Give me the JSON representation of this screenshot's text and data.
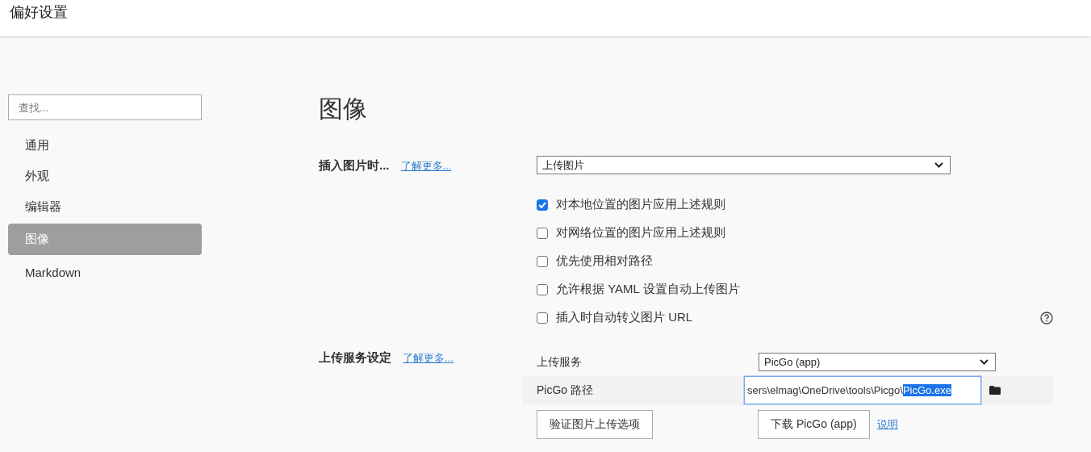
{
  "window": {
    "title": "偏好设置"
  },
  "search": {
    "placeholder": "查找..."
  },
  "sidebar": {
    "items": [
      {
        "label": "通用",
        "selected": false
      },
      {
        "label": "外观",
        "selected": false
      },
      {
        "label": "编辑器",
        "selected": false
      },
      {
        "label": "图像",
        "selected": true
      },
      {
        "label": "Markdown",
        "selected": false
      }
    ]
  },
  "page_title": "图像",
  "insert_section": {
    "label": "插入图片时...",
    "link": "了解更多...",
    "dropdown": "上传图片",
    "options": [
      {
        "label": "对本地位置的图片应用上述规则",
        "checked": true
      },
      {
        "label": "对网络位置的图片应用上述规则",
        "checked": false
      },
      {
        "label": "优先使用相对路径",
        "checked": false
      },
      {
        "label": "允许根据 YAML 设置自动上传图片",
        "checked": false
      },
      {
        "label": "插入时自动转义图片 URL",
        "checked": false
      }
    ]
  },
  "upload_section": {
    "label": "上传服务设定",
    "link": "了解更多...",
    "service_label": "上传服务",
    "service_dropdown": "PicGo (app)",
    "path_label": "PicGo 路径",
    "path_value": "sers\\elmag\\OneDrive\\tools\\Picgo\\",
    "path_selected": "PicGo.exe",
    "verify_button": "验证图片上传选项",
    "download_button": "下载 PicGo (app)",
    "help_link": "说明"
  }
}
